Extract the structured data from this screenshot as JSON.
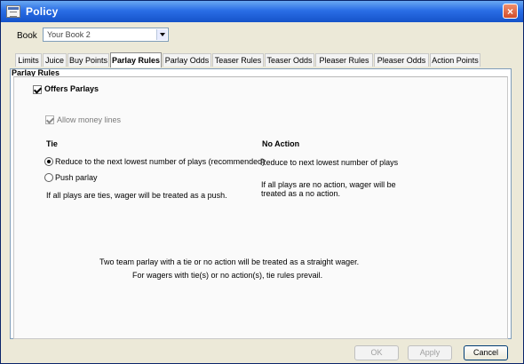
{
  "window": {
    "title": "Policy",
    "close_label": "×"
  },
  "book": {
    "label": "Book",
    "selected": "Your Book 2"
  },
  "tabs": [
    {
      "label": "Limits"
    },
    {
      "label": "Juice"
    },
    {
      "label": "Buy Points"
    },
    {
      "label": "Parlay Rules",
      "active": true
    },
    {
      "label": "Parlay Odds"
    },
    {
      "label": "Teaser Rules"
    },
    {
      "label": "Teaser Odds"
    },
    {
      "label": "Pleaser Rules"
    },
    {
      "label": "Pleaser Odds"
    },
    {
      "label": "Action Points"
    }
  ],
  "parlay_rules": {
    "section_title": "Parlay Rules",
    "offers_parlays": {
      "label": "Offers Parlays",
      "checked": true
    },
    "allow_money_lines": {
      "label": "Allow money lines",
      "checked": true,
      "disabled": true
    },
    "tie": {
      "heading": "Tie",
      "option_reduce": "Reduce to the next lowest number of plays (recommended)",
      "option_push": "Push parlay",
      "selected": "reduce",
      "note": "If all plays are ties, wager will be treated as a push."
    },
    "no_action": {
      "heading": "No Action",
      "rule": "Reduce to next lowest number of plays",
      "note": "If all plays are no action, wager will be treated as a no action."
    },
    "footer_line1": "Two team parlay with a tie or no action will be treated as a straight wager.",
    "footer_line2": "For wagers with tie(s) or no action(s), tie rules prevail."
  },
  "buttons": {
    "ok": "OK",
    "apply": "Apply",
    "cancel": "Cancel"
  }
}
